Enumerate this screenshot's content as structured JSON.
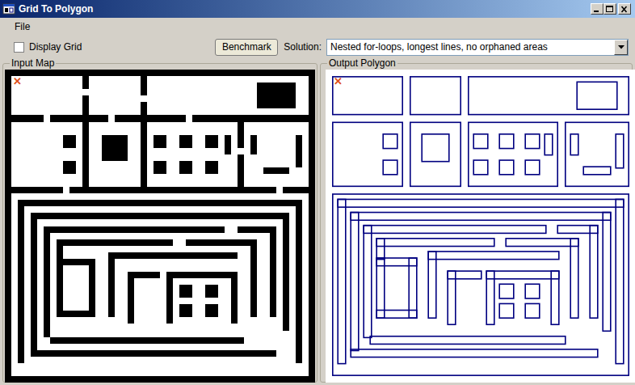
{
  "window": {
    "title": "Grid To Polygon"
  },
  "menu": [
    {
      "label": "File"
    }
  ],
  "display_grid": {
    "label": "Display Grid",
    "checked": false
  },
  "benchmark_button": {
    "label": "Benchmark"
  },
  "solution": {
    "label": "Solution:",
    "value": "Nested for-loops, longest lines, no orphaned areas"
  },
  "panels": [
    {
      "title": "Input Map",
      "kind": "input",
      "marker": "✕"
    },
    {
      "title": "Output Polygon",
      "kind": "output",
      "marker": "✕"
    }
  ]
}
